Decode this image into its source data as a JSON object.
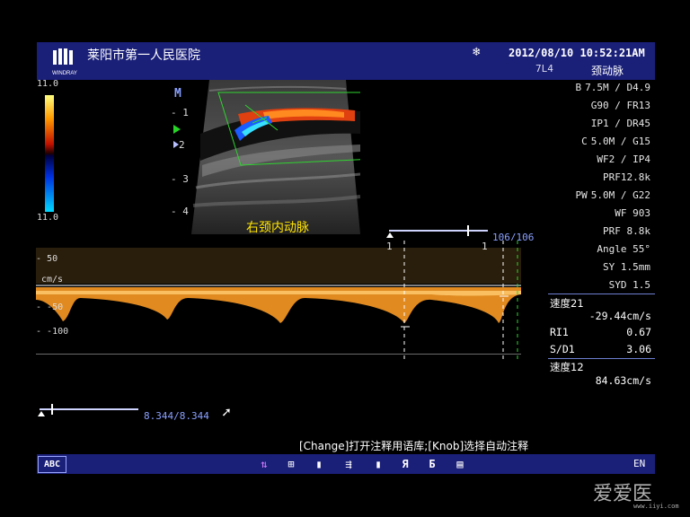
{
  "header": {
    "hospital": "莱阳市第一人民医院",
    "logo_text": "WINDRAY",
    "datetime": "2012/08/10  10:52:21AM",
    "probe": "7L4",
    "exam": "颈动脉"
  },
  "colorbar": {
    "top_value": "11.0",
    "bottom_value": "11.0"
  },
  "depth_marks": [
    "1",
    "2",
    "3",
    "4"
  ],
  "mode_mark": "M",
  "image_label": "右颈内动脉",
  "params": [
    {
      "key": "B",
      "text": "7.5M / D4.9"
    },
    {
      "key": "",
      "text": "G90 / FR13"
    },
    {
      "key": "",
      "text": "IP1 / DR45"
    },
    {
      "key": "C",
      "text": "5.0M / G15"
    },
    {
      "key": "",
      "text": "WF2 / IP4"
    },
    {
      "key": "",
      "text": "PRF12.8k"
    },
    {
      "key": "PW",
      "text": "5.0M / G22"
    },
    {
      "key": "",
      "text": "WF 903"
    },
    {
      "key": "",
      "text": "PRF 8.8k"
    },
    {
      "key": "",
      "text": "Angle 55°"
    },
    {
      "key": "",
      "text": "SY 1.5mm"
    },
    {
      "key": "",
      "text": "SYD 1.5"
    }
  ],
  "measurements": {
    "v1_label": "速度21",
    "v1_value": "-29.44cm/s",
    "ri_label": "RI1",
    "ri_value": "0.67",
    "sd_label": "S/D1",
    "sd_value": "3.06",
    "v2_label": "速度12",
    "v2_value": "84.63cm/s"
  },
  "doppler": {
    "scale_top": "50",
    "unit": "cm/s",
    "scale_mid": "-50",
    "scale_bottom": "-100",
    "frame_counter": "106/106",
    "cursor_a": "1",
    "cursor_b": "1",
    "cine_counter": "8.344/8.344"
  },
  "hint": "[Change]打开注释用语库;[Knob]选择自动注释",
  "bottom": {
    "abc": "ABC",
    "lang": "EN"
  },
  "watermark": {
    "text": "爱爱医",
    "url": "www.iiyi.com"
  }
}
